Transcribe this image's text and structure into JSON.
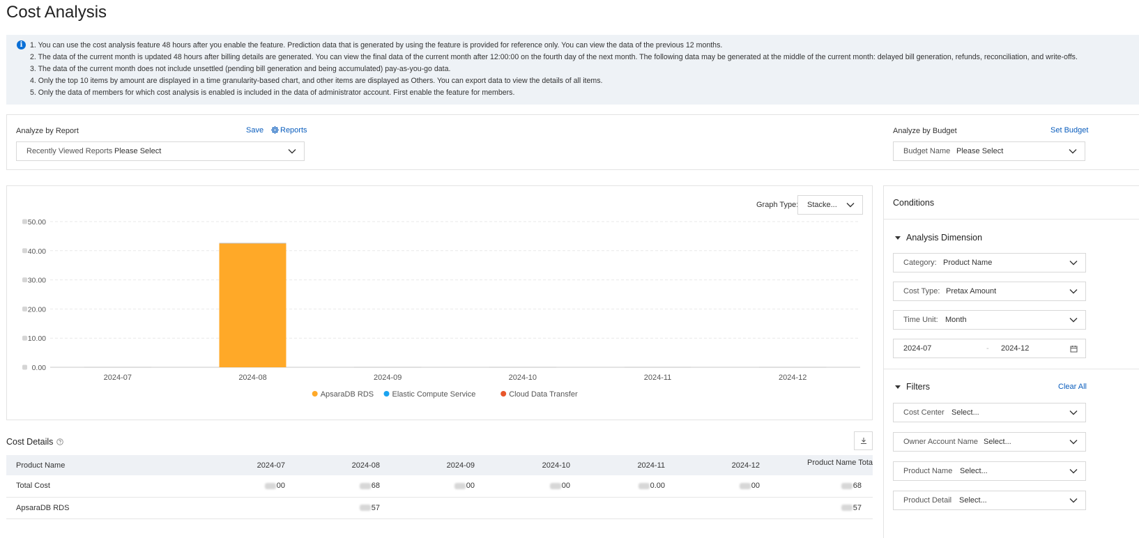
{
  "page": {
    "title": "Cost Analysis"
  },
  "notice": {
    "lines": [
      "1. You can use the cost analysis feature 48 hours after you enable the feature. Prediction data that is generated by using the feature is provided for reference only. You can view the data of the previous 12 months.",
      "2. The data of the current month is updated 48 hours after billing details are generated. You can view the final data of the current month after 12:00:00 on the fourth day of the next month. The following data may be generated at the middle of the current month: delayed bill generation, refunds, reconciliation, and write-offs.",
      "3. The data of the current month does not include unsettled (pending bill generation and being accumulated) pay-as-you-go data.",
      "4. Only the top 10 items by amount are displayed in a time granularity-based chart, and other items are displayed as Others. You can export data to view the details of all items.",
      "5. Only the data of members for which cost analysis is enabled is included in the data of administrator account. First enable the feature for members."
    ]
  },
  "report": {
    "label": "Analyze by Report",
    "save": "Save",
    "reports": "Reports",
    "select_label": "Recently Viewed Reports",
    "select_value": "Please Select"
  },
  "budget": {
    "label": "Analyze by Budget",
    "set": "Set Budget",
    "select_label": "Budget Name",
    "select_value": "Please Select"
  },
  "graph": {
    "type_label": "Graph Type:",
    "type_value": "Stacke..."
  },
  "chart_data": {
    "type": "bar",
    "categories": [
      "2024-07",
      "2024-08",
      "2024-09",
      "2024-10",
      "2024-11",
      "2024-12"
    ],
    "series": [
      {
        "name": "ApsaraDB RDS",
        "color": "#ffa928",
        "values": [
          0,
          42.57,
          0,
          0,
          0,
          0
        ]
      },
      {
        "name": "Elastic Compute Service",
        "color": "#1aa3f0",
        "values": [
          0,
          0,
          0,
          0,
          0,
          0
        ]
      },
      {
        "name": "Cloud Data Transfer",
        "color": "#e8562a",
        "values": [
          0,
          0,
          0,
          0,
          0,
          0
        ]
      }
    ],
    "yticks": [
      "0.00",
      "10.00",
      "20.00",
      "30.00",
      "40.00",
      "50.00"
    ],
    "ylim": [
      0,
      50
    ]
  },
  "conditions": {
    "title": "Conditions",
    "analysis_title": "Analysis Dimension",
    "category": {
      "label": "Category:",
      "value": "Product Name"
    },
    "cost_type": {
      "label": "Cost Type:",
      "value": "Pretax Amount"
    },
    "time_unit": {
      "label": "Time Unit:",
      "value": "Month"
    },
    "range": {
      "start": "2024-07",
      "end": "2024-12"
    },
    "filters_title": "Filters",
    "clear_all": "Clear All",
    "filters": [
      {
        "label": "Cost Center",
        "value": "Select..."
      },
      {
        "label": "Owner Account Name",
        "value": "Select..."
      },
      {
        "label": "Product Name",
        "value": "Select..."
      },
      {
        "label": "Product Detail",
        "value": "Select..."
      }
    ]
  },
  "details": {
    "title": "Cost Details",
    "headers": [
      "Product Name",
      "2024-07",
      "2024-08",
      "2024-09",
      "2024-10",
      "2024-11",
      "2024-12",
      "Product Name Tota"
    ],
    "rows": [
      {
        "name": "Total Cost",
        "cells": [
          "00",
          "68",
          "00",
          "00",
          "0.00",
          "00",
          "68"
        ]
      },
      {
        "name": "ApsaraDB RDS",
        "cells": [
          "",
          "57",
          "",
          "",
          "",
          "",
          "57"
        ]
      }
    ]
  }
}
